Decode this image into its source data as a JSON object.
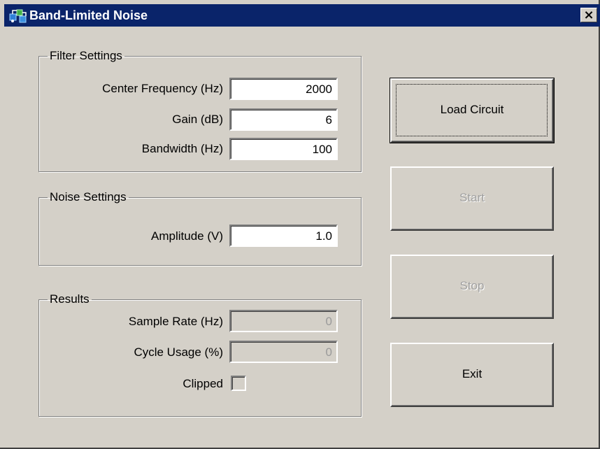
{
  "window": {
    "title": "Band-Limited Noise",
    "close_label": "×"
  },
  "filter_settings": {
    "title": "Filter Settings",
    "center_frequency": {
      "label": "Center Frequency (Hz)",
      "value": "2000"
    },
    "gain": {
      "label": "Gain (dB)",
      "value": "6"
    },
    "bandwidth": {
      "label": "Bandwidth (Hz)",
      "value": "100"
    }
  },
  "noise_settings": {
    "title": "Noise Settings",
    "amplitude": {
      "label": "Amplitude (V)",
      "value": "1.0"
    }
  },
  "results": {
    "title": "Results",
    "sample_rate": {
      "label": "Sample Rate (Hz)",
      "value": "0"
    },
    "cycle_usage": {
      "label": "Cycle Usage (%)",
      "value": "0"
    },
    "clipped": {
      "label": "Clipped",
      "checked": false
    }
  },
  "buttons": {
    "load_circuit": "Load Circuit",
    "start": "Start",
    "stop": "Stop",
    "exit": "Exit"
  },
  "colors": {
    "titlebar": "#0a246a",
    "face": "#d4d0c8",
    "disabled_text": "#a0a0a0"
  },
  "icons": {
    "app": "circuit-app-icon",
    "close": "close-icon"
  }
}
